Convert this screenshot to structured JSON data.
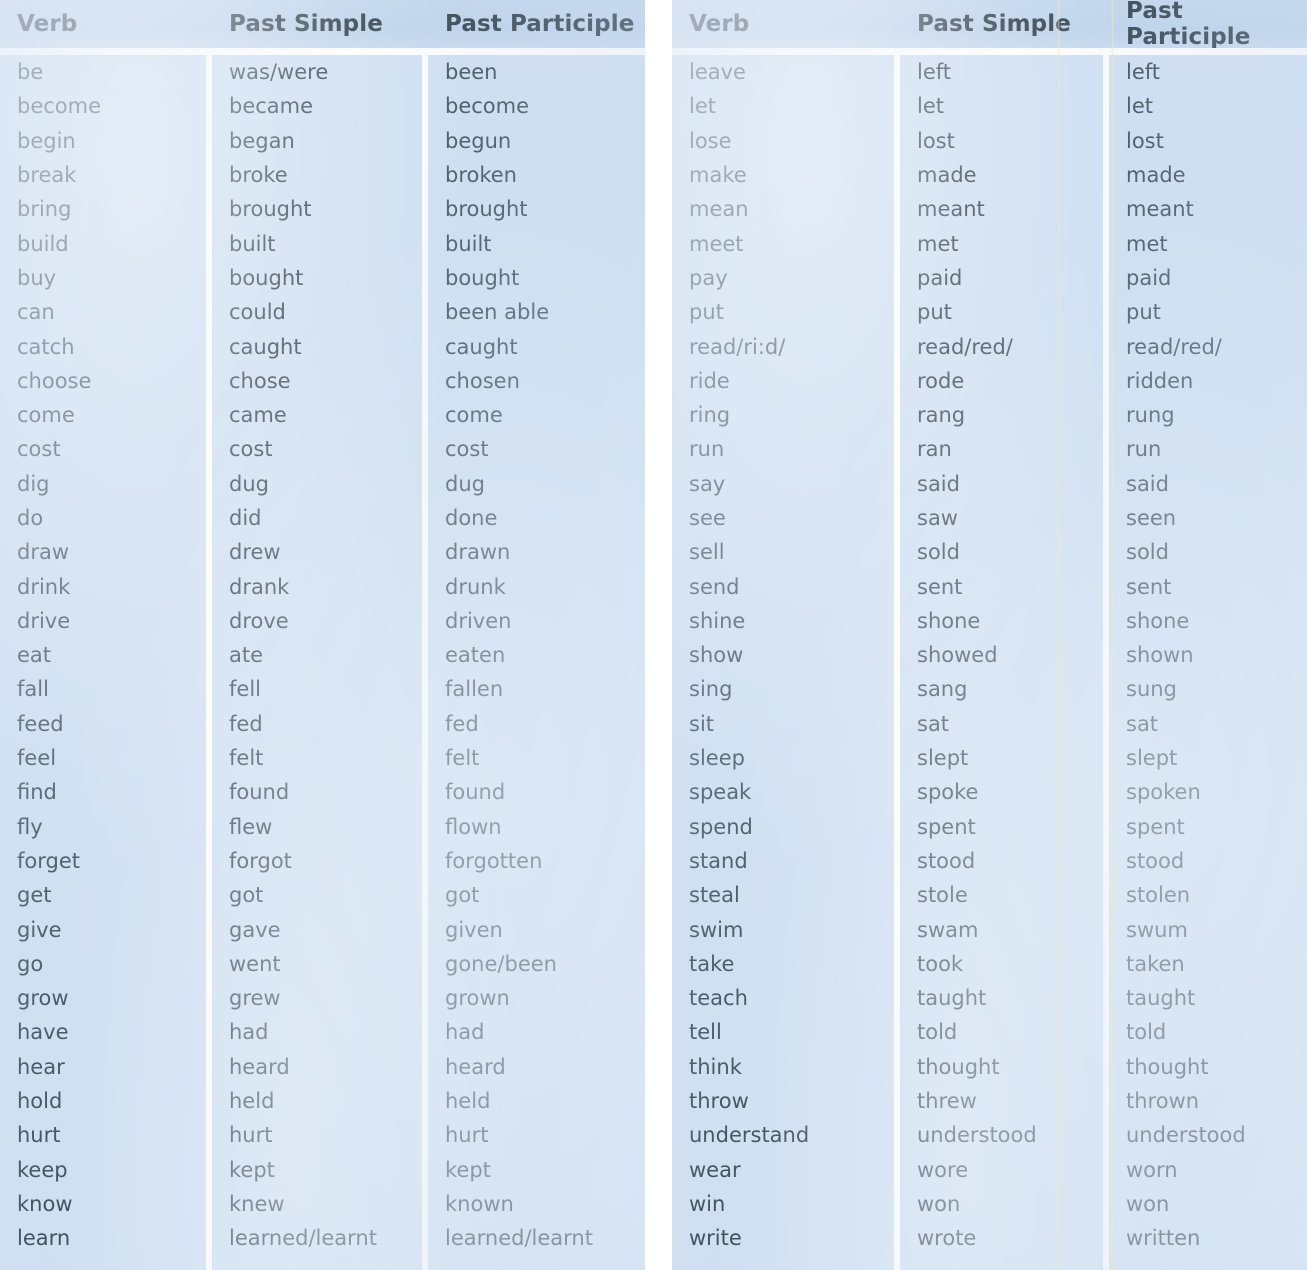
{
  "page": {
    "title": "Irregular Verbs",
    "background_color": "#ffffff",
    "table_background_color": "#cfdff1",
    "header_background_color": "#bdd2ea",
    "text_color": "#3c4a57",
    "header_text_color": "#33414e",
    "gridline_color": "#fdfdfd"
  },
  "tables": [
    {
      "id": "left",
      "headers": [
        "Verb",
        "Past Simple",
        "Past Participle"
      ],
      "rows": [
        [
          "be",
          "was/were",
          "been"
        ],
        [
          "become",
          "became",
          "become"
        ],
        [
          "begin",
          "began",
          "begun"
        ],
        [
          "break",
          "broke",
          "broken"
        ],
        [
          "bring",
          "brought",
          "brought"
        ],
        [
          "build",
          "built",
          "built"
        ],
        [
          "buy",
          "bought",
          "bought"
        ],
        [
          "can",
          "could",
          "been able"
        ],
        [
          "catch",
          "caught",
          "caught"
        ],
        [
          "choose",
          "chose",
          "chosen"
        ],
        [
          "come",
          "came",
          "come"
        ],
        [
          "cost",
          "cost",
          "cost"
        ],
        [
          "dig",
          "dug",
          "dug"
        ],
        [
          "do",
          "did",
          "done"
        ],
        [
          "draw",
          "drew",
          "drawn"
        ],
        [
          "drink",
          "drank",
          "drunk"
        ],
        [
          "drive",
          "drove",
          "driven"
        ],
        [
          "eat",
          "ate",
          "eaten"
        ],
        [
          "fall",
          "fell",
          "fallen"
        ],
        [
          "feed",
          "fed",
          "fed"
        ],
        [
          "feel",
          "felt",
          "felt"
        ],
        [
          "find",
          "found",
          "found"
        ],
        [
          "fly",
          "flew",
          "flown"
        ],
        [
          "forget",
          "forgot",
          "forgotten"
        ],
        [
          "get",
          "got",
          "got"
        ],
        [
          "give",
          "gave",
          "given"
        ],
        [
          "go",
          "went",
          "gone/been"
        ],
        [
          "grow",
          "grew",
          "grown"
        ],
        [
          "have",
          "had",
          "had"
        ],
        [
          "hear",
          "heard",
          "heard"
        ],
        [
          "hold",
          "held",
          "held"
        ],
        [
          "hurt",
          "hurt",
          "hurt"
        ],
        [
          "keep",
          "kept",
          "kept"
        ],
        [
          "know",
          "knew",
          "known"
        ],
        [
          "learn",
          "learned/learnt",
          "learned/learnt"
        ]
      ]
    },
    {
      "id": "right",
      "headers": [
        "Verb",
        "Past Simple",
        "Past Participle"
      ],
      "rows": [
        [
          "leave",
          "left",
          "left"
        ],
        [
          "let",
          "let",
          "let"
        ],
        [
          "lose",
          "lost",
          "lost"
        ],
        [
          "make",
          "made",
          "made"
        ],
        [
          "mean",
          "meant",
          "meant"
        ],
        [
          "meet",
          "met",
          "met"
        ],
        [
          "pay",
          "paid",
          "paid"
        ],
        [
          "put",
          "put",
          "put"
        ],
        [
          "read/ri:d/",
          "read/red/",
          "read/red/"
        ],
        [
          "ride",
          "rode",
          "ridden"
        ],
        [
          "ring",
          "rang",
          "rung"
        ],
        [
          "run",
          "ran",
          "run"
        ],
        [
          "say",
          "said",
          "said"
        ],
        [
          "see",
          "saw",
          "seen"
        ],
        [
          "sell",
          "sold",
          "sold"
        ],
        [
          "send",
          "sent",
          "sent"
        ],
        [
          "shine",
          "shone",
          "shone"
        ],
        [
          "show",
          "showed",
          "shown"
        ],
        [
          "sing",
          "sang",
          "sung"
        ],
        [
          "sit",
          "sat",
          "sat"
        ],
        [
          "sleep",
          "slept",
          "slept"
        ],
        [
          "speak",
          "spoke",
          "spoken"
        ],
        [
          "spend",
          "spent",
          "spent"
        ],
        [
          "stand",
          "stood",
          "stood"
        ],
        [
          "steal",
          "stole",
          "stolen"
        ],
        [
          "swim",
          "swam",
          "swum"
        ],
        [
          "take",
          "took",
          "taken"
        ],
        [
          "teach",
          "taught",
          "taught"
        ],
        [
          "tell",
          "told",
          "told"
        ],
        [
          "think",
          "thought",
          "thought"
        ],
        [
          "throw",
          "threw",
          "thrown"
        ],
        [
          "understand",
          "understood",
          "understood"
        ],
        [
          "wear",
          "wore",
          "worn"
        ],
        [
          "win",
          "won",
          "won"
        ],
        [
          "write",
          "wrote",
          "written"
        ]
      ]
    }
  ]
}
